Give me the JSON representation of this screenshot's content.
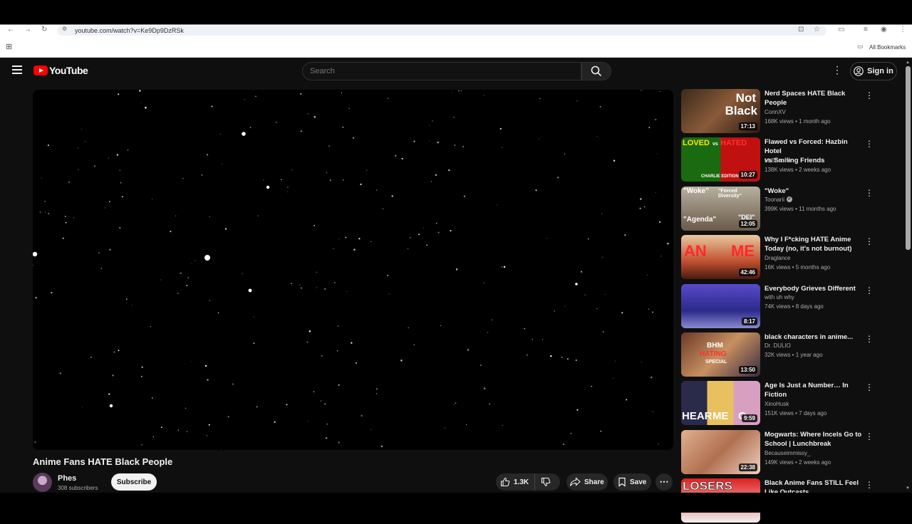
{
  "browser": {
    "url": "youtube.com/watch?v=Ke9Dp9DzRSk",
    "bookmarks_label": "All Bookmarks"
  },
  "header": {
    "logo_text": "YouTube",
    "search_placeholder": "Search",
    "signin_label": "Sign in"
  },
  "video": {
    "title": "Anime Fans HATE Black People",
    "channel": "Phes",
    "subscribers": "308 subscribers",
    "subscribe_label": "Subscribe",
    "likes": "1.3K",
    "share_label": "Share",
    "save_label": "Save"
  },
  "recommendations": [
    {
      "title_line1": "Nerd Spaces HATE Black",
      "title_line2": "People",
      "channel": "CorinXV",
      "meta": "168K views • 1 month ago",
      "duration": "17:13",
      "thumb_text": [
        "Not",
        "Black"
      ],
      "verified": false
    },
    {
      "title_line1": "Flawed vs Forced: Hazbin Hotel",
      "title_line2": "vs Smiling Friends",
      "channel": "MrBooone",
      "meta": "138K views • 2 weeks ago",
      "duration": "10:27",
      "thumb_text": [
        "LOVED",
        "vs",
        "HATED",
        "CHARLIE EDITION"
      ],
      "verified": false
    },
    {
      "title_line1": "\"Woke\"",
      "title_line2": "",
      "channel": "Toonarii",
      "meta": "399K views • 11 months ago",
      "duration": "12:05",
      "thumb_text": [
        "\"Woke\"",
        "\"Forced Diversity\"",
        "\"Agenda\"",
        "\"DEI\""
      ],
      "verified": true
    },
    {
      "title_line1": "Why I F*cking HATE Anime",
      "title_line2": "Today (no, it's not burnout)",
      "channel": "Draglance",
      "meta": "16K views • 5 months ago",
      "duration": "42:46",
      "thumb_text": [
        "AN",
        "ME"
      ],
      "verified": false
    },
    {
      "title_line1": "Everybody Grieves Different",
      "title_line2": "",
      "channel": "with uh why",
      "meta": "74K views • 8 days ago",
      "duration": "8:17",
      "thumb_text": [],
      "verified": false
    },
    {
      "title_line1": "black characters in anime...",
      "title_line2": "",
      "channel": "Dr. DULIO",
      "meta": "32K views • 1 year ago",
      "duration": "13:50",
      "thumb_text": [
        "BHM",
        "HATING",
        "SPECIAL"
      ],
      "verified": false
    },
    {
      "title_line1": "Age Is Just a Number… In",
      "title_line2": "Fiction",
      "channel": "XinoHusk",
      "meta": "151K views • 7 days ago",
      "duration": "9:59",
      "thumb_text": [
        "HEAR",
        "ME",
        "O"
      ],
      "verified": false
    },
    {
      "title_line1": "Mogwarts: Where Incels Go to",
      "title_line2": "School | Lunchbreak",
      "channel": "Becauseimmissy_",
      "meta": "149K views • 2 weeks ago",
      "duration": "22:38",
      "thumb_text": [],
      "verified": false
    },
    {
      "title_line1": "Black Anime Fans STILL Feel",
      "title_line2": "Like Outcasts",
      "channel": "",
      "meta": "",
      "duration": "",
      "thumb_text": [
        "LOSERS"
      ],
      "verified": false
    }
  ],
  "colors": {
    "background": "#0f0f0f",
    "brand_red": "#ff0000",
    "text_primary": "#f1f1f1",
    "text_secondary": "#aaaaaa"
  }
}
